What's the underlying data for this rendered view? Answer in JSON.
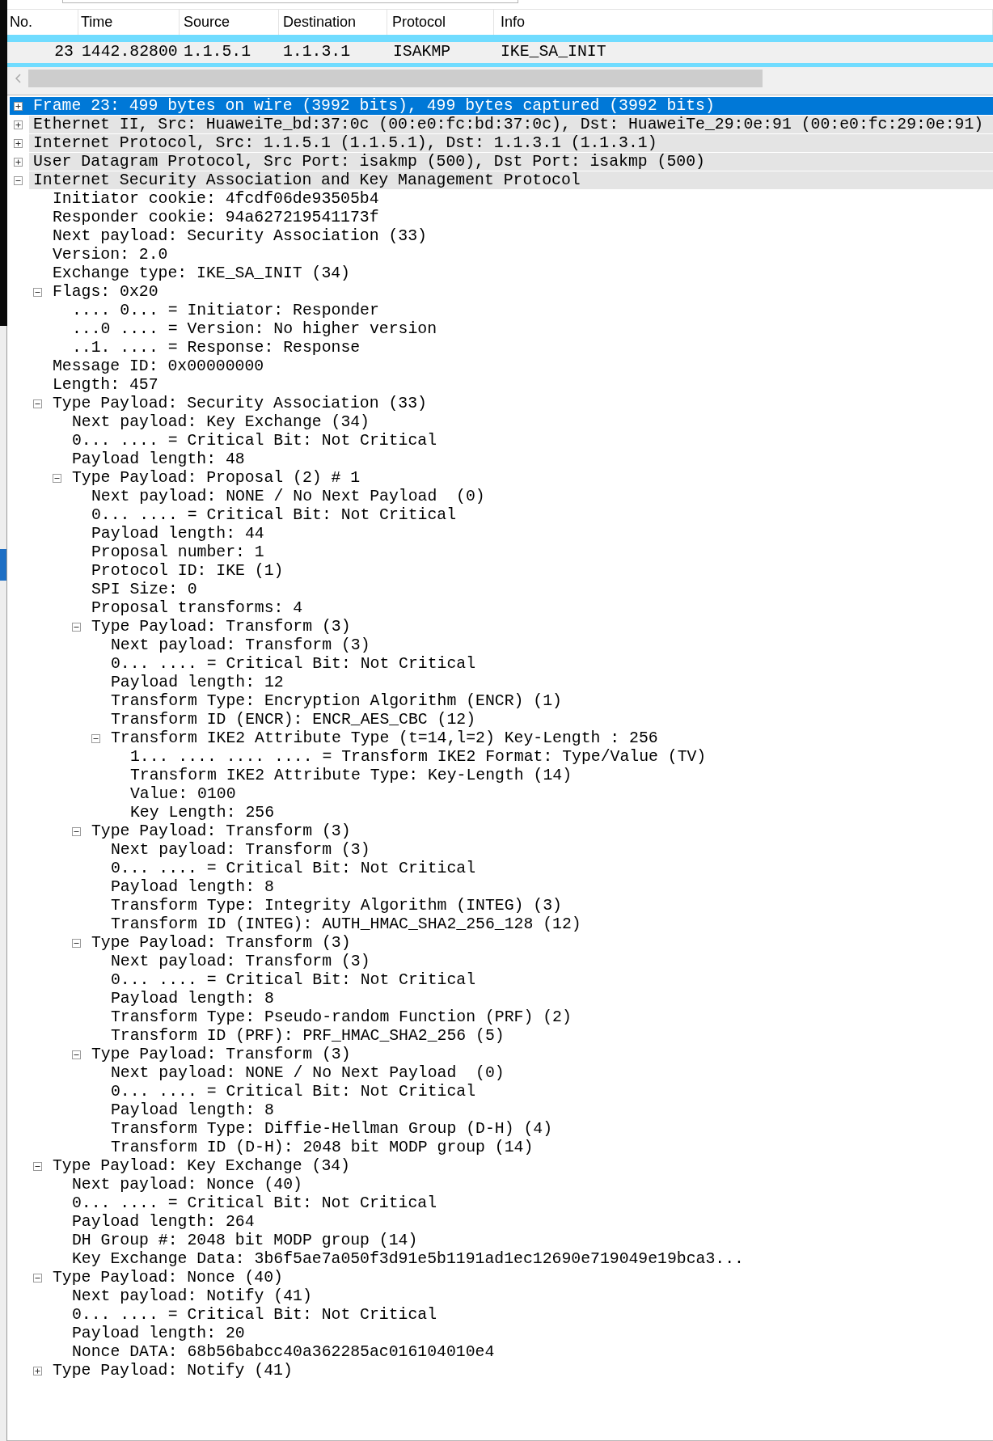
{
  "packet_list": {
    "columns": [
      "No.",
      "Time",
      "Source",
      "Destination",
      "Protocol",
      "Info"
    ],
    "rows": [
      {
        "selected": false,
        "color": "#70dcff"
      },
      {
        "selected": true,
        "cells": [
          "23",
          "1442.82800",
          "1.1.5.1",
          "1.1.3.1",
          "ISAKMP",
          "IKE_SA_INIT"
        ]
      },
      {
        "selected": false,
        "color": "#70dcff"
      }
    ]
  },
  "tree": [
    {
      "label": "Frame 23: 499 bytes on wire (3992 bits), 499 bytes captured (3992 bits)",
      "expanded": false,
      "selected": true
    },
    {
      "label": "Ethernet II, Src: HuaweiTe_bd:37:0c (00:e0:fc:bd:37:0c), Dst: HuaweiTe_29:0e:91 (00:e0:fc:29:0e:91)",
      "expanded": false,
      "selected": false
    },
    {
      "label": "Internet Protocol, Src: 1.1.5.1 (1.1.5.1), Dst: 1.1.3.1 (1.1.3.1)",
      "expanded": false,
      "selected": false
    },
    {
      "label": "User Datagram Protocol, Src Port: isakmp (500), Dst Port: isakmp (500)",
      "expanded": false,
      "selected": false
    },
    {
      "label": "Internet Security Association and Key Management Protocol",
      "expanded": true,
      "selected": false,
      "children": [
        {
          "label": "Initiator cookie: 4fcdf06de93505b4",
          "selected": false
        },
        {
          "label": "Responder cookie: 94a627219541173f",
          "selected": false
        },
        {
          "label": "Next payload: Security Association (33)",
          "selected": false
        },
        {
          "label": "Version: 2.0",
          "selected": false
        },
        {
          "label": "Exchange type: IKE_SA_INIT (34)",
          "selected": false
        },
        {
          "label": "Flags: 0x20",
          "expanded": true,
          "selected": false,
          "children": [
            {
              "label": ".... 0... = Initiator: Responder",
              "selected": false
            },
            {
              "label": "...0 .... = Version: No higher version",
              "selected": false
            },
            {
              "label": "..1. .... = Response: Response",
              "selected": false
            }
          ]
        },
        {
          "label": "Message ID: 0x00000000",
          "selected": false
        },
        {
          "label": "Length: 457",
          "selected": false
        },
        {
          "label": "Type Payload: Security Association (33)",
          "expanded": true,
          "selected": false,
          "children": [
            {
              "label": "Next payload: Key Exchange (34)",
              "selected": false
            },
            {
              "label": "0... .... = Critical Bit: Not Critical",
              "selected": false
            },
            {
              "label": "Payload length: 48",
              "selected": false
            },
            {
              "label": "Type Payload: Proposal (2) # 1",
              "expanded": true,
              "selected": false,
              "children": [
                {
                  "label": "Next payload: NONE / No Next Payload  (0)",
                  "selected": false
                },
                {
                  "label": "0... .... = Critical Bit: Not Critical",
                  "selected": false
                },
                {
                  "label": "Payload length: 44",
                  "selected": false
                },
                {
                  "label": "Proposal number: 1",
                  "selected": false
                },
                {
                  "label": "Protocol ID: IKE (1)",
                  "selected": false
                },
                {
                  "label": "SPI Size: 0",
                  "selected": false
                },
                {
                  "label": "Proposal transforms: 4",
                  "selected": false
                },
                {
                  "label": "Type Payload: Transform (3)",
                  "expanded": true,
                  "selected": false,
                  "children": [
                    {
                      "label": "Next payload: Transform (3)",
                      "selected": false
                    },
                    {
                      "label": "0... .... = Critical Bit: Not Critical",
                      "selected": false
                    },
                    {
                      "label": "Payload length: 12",
                      "selected": false
                    },
                    {
                      "label": "Transform Type: Encryption Algorithm (ENCR) (1)",
                      "selected": false
                    },
                    {
                      "label": "Transform ID (ENCR): ENCR_AES_CBC (12)",
                      "selected": false
                    },
                    {
                      "label": "Transform IKE2 Attribute Type (t=14,l=2) Key-Length : 256",
                      "expanded": true,
                      "selected": false,
                      "children": [
                        {
                          "label": "1... .... .... .... = Transform IKE2 Format: Type/Value (TV)",
                          "selected": false
                        },
                        {
                          "label": "Transform IKE2 Attribute Type: Key-Length (14)",
                          "selected": false
                        },
                        {
                          "label": "Value: 0100",
                          "selected": false
                        },
                        {
                          "label": "Key Length: 256",
                          "selected": false
                        }
                      ]
                    }
                  ]
                },
                {
                  "label": "Type Payload: Transform (3)",
                  "expanded": true,
                  "selected": false,
                  "children": [
                    {
                      "label": "Next payload: Transform (3)",
                      "selected": false
                    },
                    {
                      "label": "0... .... = Critical Bit: Not Critical",
                      "selected": false
                    },
                    {
                      "label": "Payload length: 8",
                      "selected": false
                    },
                    {
                      "label": "Transform Type: Integrity Algorithm (INTEG) (3)",
                      "selected": false
                    },
                    {
                      "label": "Transform ID (INTEG): AUTH_HMAC_SHA2_256_128 (12)",
                      "selected": false
                    }
                  ]
                },
                {
                  "label": "Type Payload: Transform (3)",
                  "expanded": true,
                  "selected": false,
                  "children": [
                    {
                      "label": "Next payload: Transform (3)",
                      "selected": false
                    },
                    {
                      "label": "0... .... = Critical Bit: Not Critical",
                      "selected": false
                    },
                    {
                      "label": "Payload length: 8",
                      "selected": false
                    },
                    {
                      "label": "Transform Type: Pseudo-random Function (PRF) (2)",
                      "selected": false
                    },
                    {
                      "label": "Transform ID (PRF): PRF_HMAC_SHA2_256 (5)",
                      "selected": false
                    }
                  ]
                },
                {
                  "label": "Type Payload: Transform (3)",
                  "expanded": true,
                  "selected": false,
                  "children": [
                    {
                      "label": "Next payload: NONE / No Next Payload  (0)",
                      "selected": false
                    },
                    {
                      "label": "0... .... = Critical Bit: Not Critical",
                      "selected": false
                    },
                    {
                      "label": "Payload length: 8",
                      "selected": false
                    },
                    {
                      "label": "Transform Type: Diffie-Hellman Group (D-H) (4)",
                      "selected": false
                    },
                    {
                      "label": "Transform ID (D-H): 2048 bit MODP group (14)",
                      "selected": false
                    }
                  ]
                }
              ]
            }
          ]
        },
        {
          "label": "Type Payload: Key Exchange (34)",
          "expanded": true,
          "selected": false,
          "children": [
            {
              "label": "Next payload: Nonce (40)",
              "selected": false
            },
            {
              "label": "0... .... = Critical Bit: Not Critical",
              "selected": false
            },
            {
              "label": "Payload length: 264",
              "selected": false
            },
            {
              "label": "DH Group #: 2048 bit MODP group (14)",
              "selected": false
            },
            {
              "label": "Key Exchange Data: 3b6f5ae7a050f3d91e5b1191ad1ec12690e719049e19bca3...",
              "selected": false
            }
          ]
        },
        {
          "label": "Type Payload: Nonce (40)",
          "expanded": true,
          "selected": false,
          "children": [
            {
              "label": "Next payload: Notify (41)",
              "selected": false
            },
            {
              "label": "0... .... = Critical Bit: Not Critical",
              "selected": false
            },
            {
              "label": "Payload length: 20",
              "selected": false
            },
            {
              "label": "Nonce DATA: 68b56babcc40a362285ac016104010e4",
              "selected": false
            }
          ]
        },
        {
          "label": "Type Payload: Notify (41)",
          "expanded": false,
          "selected": false
        }
      ]
    }
  ]
}
